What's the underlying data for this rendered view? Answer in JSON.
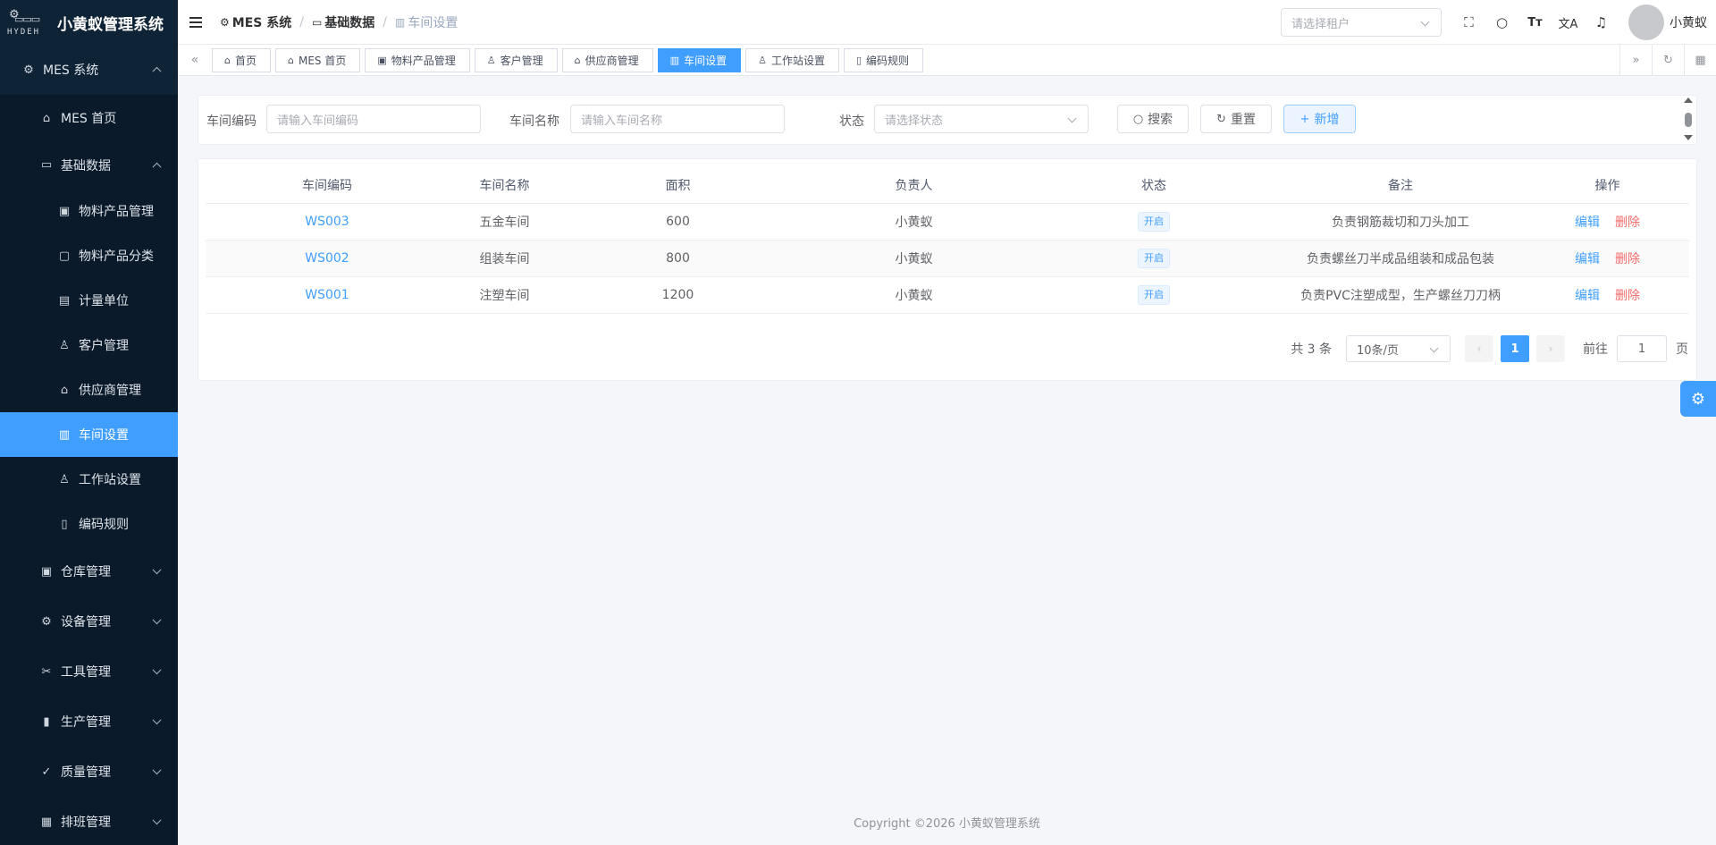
{
  "app": {
    "title": "小黄蚁管理系统",
    "brand": "HYDEH"
  },
  "sidebar": {
    "top": {
      "label": "MES 系统",
      "icon": "cpu-icon",
      "expanded": true
    },
    "items": [
      {
        "label": "MES 首页",
        "icon": "home-icon"
      },
      {
        "label": "基础数据",
        "icon": "monitor-icon",
        "expanded": true
      },
      {
        "label": "物料产品管理",
        "icon": "box-icon"
      },
      {
        "label": "物料产品分类",
        "icon": "briefcase-icon"
      },
      {
        "label": "计量单位",
        "icon": "unit-icon"
      },
      {
        "label": "客户管理",
        "icon": "user-icon"
      },
      {
        "label": "供应商管理",
        "icon": "bag-icon"
      },
      {
        "label": "车间设置",
        "icon": "building-icon",
        "active": true
      },
      {
        "label": "工作站设置",
        "icon": "user-station-icon"
      },
      {
        "label": "编码规则",
        "icon": "document-icon"
      },
      {
        "label": "仓库管理",
        "icon": "warehouse-icon"
      },
      {
        "label": "设备管理",
        "icon": "cpu-icon"
      },
      {
        "label": "工具管理",
        "icon": "scissors-icon"
      },
      {
        "label": "生产管理",
        "icon": "bars-icon"
      },
      {
        "label": "质量管理",
        "icon": "check-icon"
      },
      {
        "label": "排班管理",
        "icon": "calendar-icon"
      }
    ]
  },
  "header": {
    "breadcrumb": [
      "MES 系统",
      "基础数据",
      "车间设置"
    ],
    "tenant_placeholder": "请选择租户",
    "username": "小黄蚁"
  },
  "tags": [
    "首页",
    "MES 首页",
    "物料产品管理",
    "客户管理",
    "供应商管理",
    "车间设置",
    "工作站设置",
    "编码规则"
  ],
  "search": {
    "code_label": "车间编码",
    "code_placeholder": "请输入车间编码",
    "name_label": "车间名称",
    "name_placeholder": "请输入车间名称",
    "status_label": "状态",
    "status_placeholder": "请选择状态",
    "search_btn": "搜索",
    "reset_btn": "重置",
    "add_btn": "新增"
  },
  "table": {
    "columns": [
      "车间编码",
      "车间名称",
      "面积",
      "负责人",
      "状态",
      "备注",
      "操作"
    ],
    "rows": [
      {
        "code": "WS003",
        "name": "五金车间",
        "area": "600",
        "owner": "小黄蚁",
        "status": "开启",
        "remark": "负责钢筋裁切和刀头加工"
      },
      {
        "code": "WS002",
        "name": "组装车间",
        "area": "800",
        "owner": "小黄蚁",
        "status": "开启",
        "remark": "负责螺丝刀半成品组装和成品包装"
      },
      {
        "code": "WS001",
        "name": "注塑车间",
        "area": "1200",
        "owner": "小黄蚁",
        "status": "开启",
        "remark": "负责PVC注塑成型，生产螺丝刀刀柄"
      }
    ],
    "edit_label": "编辑",
    "delete_label": "删除"
  },
  "pagination": {
    "total": "共 3 条",
    "page_size": "10条/页",
    "current_page": "1",
    "goto_label": "前往",
    "goto_value": "1",
    "page_suffix": "页"
  },
  "footer": "Copyright ©2026 小黄蚁管理系统",
  "colors": {
    "sidebar_bg": "#0f2337",
    "primary": "#409eff",
    "danger": "#f56c6c"
  }
}
